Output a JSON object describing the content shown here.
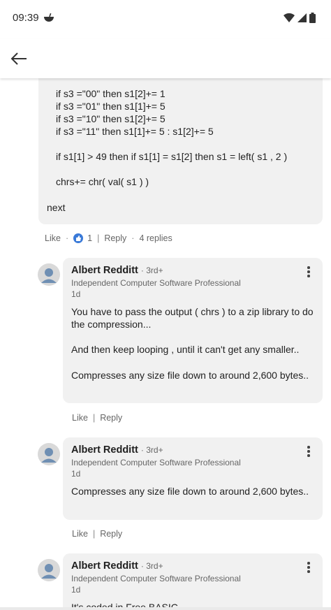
{
  "status": {
    "time": "09:39",
    "notification_icon": "bowl-icon",
    "wifi_icon": "wifi-icon",
    "signal_icon": "signal-icon",
    "battery_icon": "battery-icon"
  },
  "appbar": {
    "back_icon": "arrow-left-icon"
  },
  "post": {
    "code_lines": [
      "if s3 =\"00\" then s1[2]+= 1",
      "if s3 =\"01\" then s1[1]+= 5",
      "if s3 =\"10\" then s1[2]+= 5",
      "if s3 =\"11\" then s1[1]+= 5 : s1[2]+= 5",
      "if s1[1] > 49 then if s1[1] = s1[2] then s1 = left( s1 , 2 )",
      "chrs+= chr( val( s1 ) )"
    ],
    "next": "next",
    "actions": {
      "like": "Like",
      "reaction_count": "1",
      "reply": "Reply",
      "replies": "4 replies",
      "dot": "·",
      "bar": "|"
    }
  },
  "replies": [
    {
      "author": "Albert Redditt",
      "degree": "· 3rd+",
      "headline": "Independent Computer Software Professional",
      "time": "1d",
      "paragraphs": [
        "You have to pass the output ( chrs ) to a zip library to do the compression...",
        "And then keep looping , until it can't get any smaller..",
        "Compresses any size file down to around 2,600 bytes.."
      ],
      "like": "Like",
      "reply": "Reply",
      "bar": "|"
    },
    {
      "author": "Albert Redditt",
      "degree": "· 3rd+",
      "headline": "Independent Computer Software Professional",
      "time": "1d",
      "paragraphs": [
        "Compresses any size file down to around 2,600 bytes.."
      ],
      "like": "Like",
      "reply": "Reply",
      "bar": "|"
    },
    {
      "author": "Albert Redditt",
      "degree": "· 3rd+",
      "headline": "Independent Computer Software Professional",
      "time": "1d",
      "paragraphs": [
        "It's coded in Free BASIC"
      ]
    }
  ],
  "colors": {
    "bubble": "#f1f1f1",
    "like_badge": "#3a7ad8",
    "muted_text": "#666666"
  }
}
